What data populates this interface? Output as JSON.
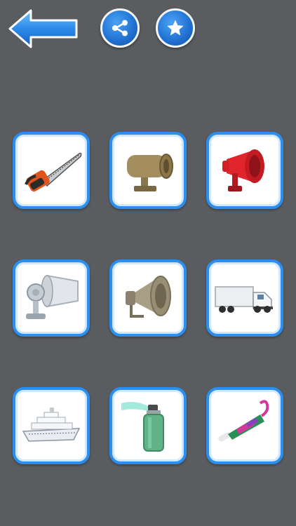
{
  "toolbar": {
    "back_icon": "left-arrow-icon",
    "share_icon": "share-icon",
    "favorite_icon": "star-icon",
    "accent_color": "#1f6fd0"
  },
  "sounds": [
    {
      "id": "chainsaw",
      "icon": "chainsaw-icon"
    },
    {
      "id": "siren",
      "icon": "siren-icon"
    },
    {
      "id": "red-megaphone",
      "icon": "megaphone-icon"
    },
    {
      "id": "alarm-horn",
      "icon": "alarm-horn-icon"
    },
    {
      "id": "horn-speaker",
      "icon": "horn-speaker-icon"
    },
    {
      "id": "truck",
      "icon": "truck-icon"
    },
    {
      "id": "ship",
      "icon": "ship-icon"
    },
    {
      "id": "air-horn-can",
      "icon": "air-horn-icon"
    },
    {
      "id": "party-horn",
      "icon": "party-horn-icon"
    }
  ],
  "colors": {
    "background": "#5b5c60",
    "tile_border": "#2a8ff0",
    "tile_fill": "#ffffff"
  }
}
